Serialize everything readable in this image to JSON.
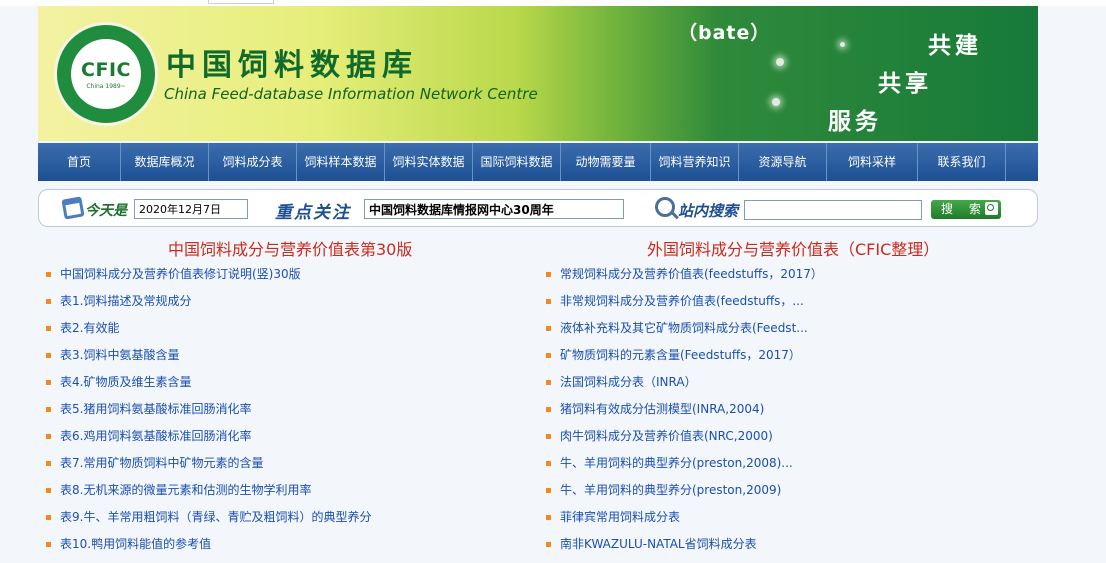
{
  "banner": {
    "logo_text": "CFIC",
    "logo_year": "China 1989~",
    "title_cn": "中国饲料数据库",
    "title_en": "China Feed-database Information Network Centre",
    "bate": "（bate）",
    "slogan": [
      "共建",
      "共享",
      "服务"
    ]
  },
  "nav": {
    "items": [
      "首页",
      "数据库概况",
      "饲料成分表",
      "饲料样本数据",
      "饲料实体数据",
      "国际饲料数据",
      "动物需要量",
      "饲料营养知识",
      "资源导航",
      "饲料采样",
      "联系我们"
    ]
  },
  "infobar": {
    "today_label": "今天是",
    "date_value": "2020年12月7日",
    "focus_label": "重点关注",
    "focus_value": "中国饲料数据库情报网中心30周年",
    "search_label": "站内搜索",
    "search_value": "",
    "search_button": "搜 索"
  },
  "left_column": {
    "title": "中国饲料成分与营养价值表第30版",
    "items": [
      "中国饲料成分及营养价值表修订说明(竖)30版",
      "表1.饲料描述及常规成分",
      "表2.有效能",
      "表3.饲料中氨基酸含量",
      "表4.矿物质及维生素含量",
      "表5.猪用饲料氨基酸标准回肠消化率",
      "表6.鸡用饲料氨基酸标准回肠消化率",
      "表7.常用矿物质饲料中矿物元素的含量",
      "表8.无机来源的微量元素和估测的生物学利用率",
      "表9.牛、羊常用粗饲料（青绿、青贮及粗饲料）的典型养分",
      "表10.鸭用饲料能值的参考值"
    ]
  },
  "right_column": {
    "title": "外国饲料成分与营养价值表（CFIC整理）",
    "items": [
      "常规饲料成分及营养价值表(feedstuffs，2017）",
      "非常规饲料成分及营养价值表(feedstuffs，...",
      "液体补充料及其它矿物质饲料成分表(Feedst...",
      "矿物质饲料的元素含量(Feedstuffs，2017）",
      "法国饲料成分表（INRA）",
      "猪饲料有效成分估测模型(INRA,2004)",
      "肉牛饲料成分及营养价值表(NRC,2000)",
      "牛、羊用饲料的典型养分(preston,2008)...",
      "牛、羊用饲料的典型养分(preston,2009)",
      "菲律宾常用饲料成分表",
      "南非KWAZULU-NATAL省饲料成分表"
    ]
  }
}
